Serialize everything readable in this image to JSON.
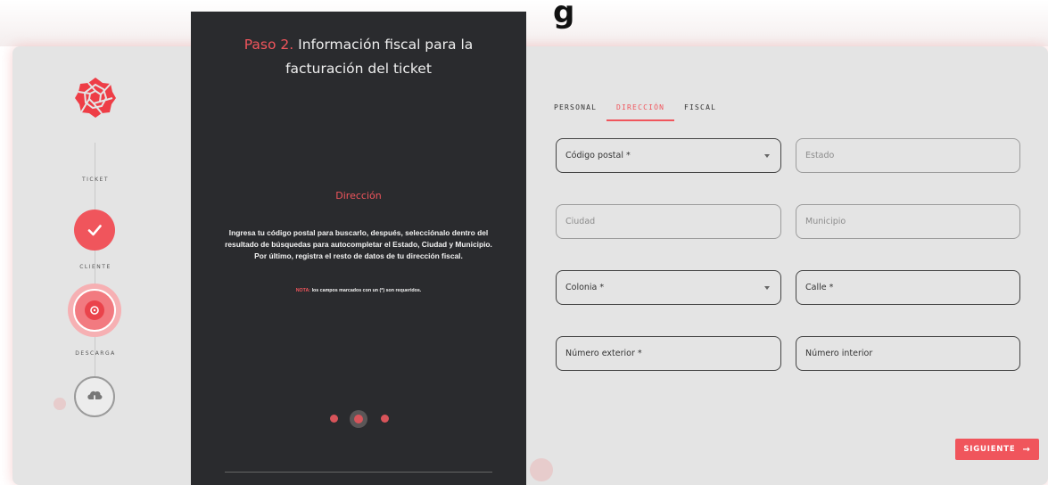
{
  "header": {
    "cut_text": "g"
  },
  "stepper": {
    "steps": [
      {
        "label": "TICKET",
        "state": "done"
      },
      {
        "label": "CLIENTE",
        "state": "active"
      },
      {
        "label": "DESCARGA",
        "state": "pending"
      }
    ]
  },
  "panel": {
    "title_prefix": "Paso",
    "title_step": "2.",
    "title_rest_1": "Información fiscal para la",
    "title_rest_2": "facturación del ticket",
    "section": "Dirección",
    "description": "Ingresa tu código postal para buscarlo, después, selecciónalo dentro del resultado de búsquedas para autocompletar el Estado, Ciudad y Municipio. Por último, registra el resto de datos de tu dirección fiscal.",
    "note_label": "NOTA:",
    "note_text": "los campos marcados con un (*) son requeridos.",
    "carousel_active": 2,
    "carousel_total": 3
  },
  "tabs": [
    {
      "label": "PERSONAL",
      "active": false
    },
    {
      "label": "DIRECCIÓN",
      "active": true
    },
    {
      "label": "FISCAL",
      "active": false
    }
  ],
  "form": {
    "codigo_postal": "Código postal *",
    "estado": "Estado",
    "ciudad": "Ciudad",
    "municipio": "Municipio",
    "colonia": "Colonia *",
    "calle": "Calle *",
    "numero_exterior": "Número exterior *",
    "numero_interior": "Número interior"
  },
  "actions": {
    "next_label": "SIGUIENTE",
    "next_icon": "arrow-right-icon"
  },
  "colors": {
    "accent": "#f0555c",
    "panel": "#2a2b2e",
    "card": "#e4e4e4"
  }
}
